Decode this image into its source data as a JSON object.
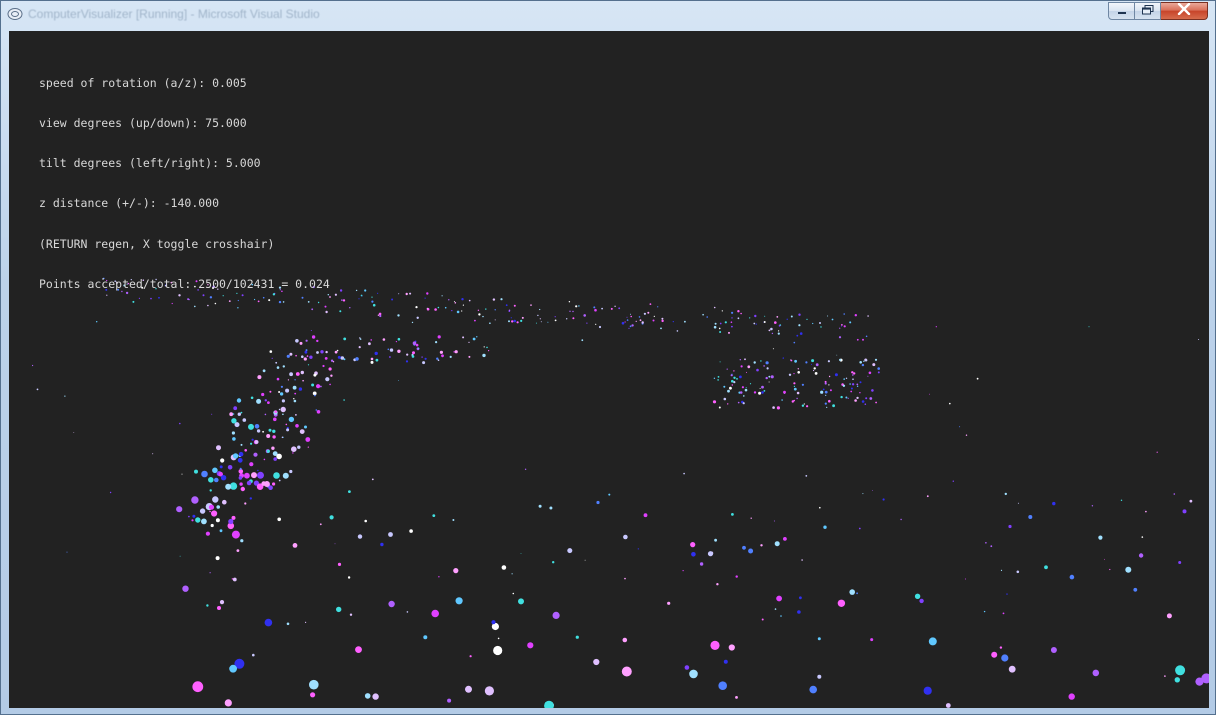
{
  "window": {
    "title": "ComputerVisualizer [Running] - Microsoft Visual Studio",
    "icons": {
      "app": "app-window-icon",
      "minimize": "minimize-icon",
      "maximize": "maximize-icon",
      "close": "close-icon"
    }
  },
  "console": {
    "lines": [
      "speed of rotation (a/z): 0.005",
      "view degrees (up/down): 75.000",
      "tilt degrees (left/right): 5.000",
      "z distance (+/-): -140.000",
      "(RETURN regen, X toggle crosshair)",
      "Points accepted/total: 2500/102431 = 0.024"
    ]
  },
  "scene": {
    "background": "#222222",
    "palette": [
      "#ffffff",
      "#c8c8ff",
      "#a0e0ff",
      "#60c8ff",
      "#40e0e0",
      "#5080ff",
      "#3030f0",
      "#8040ff",
      "#b060ff",
      "#e040ff",
      "#ff60ff",
      "#ffa0ff",
      "#e0c0ff"
    ],
    "points_accepted": 2500,
    "points_total": 102431
  }
}
